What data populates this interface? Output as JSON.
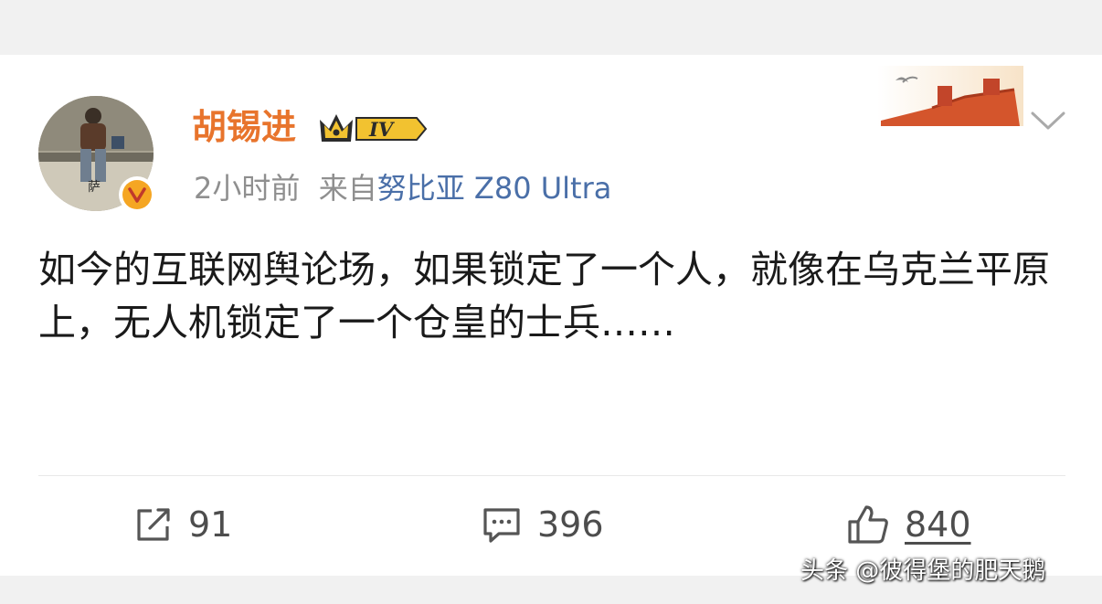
{
  "post": {
    "author": {
      "name": "胡锡进",
      "vip_level": "IV",
      "verified_icon": "verified-v-icon",
      "avatar_caption": "萨"
    },
    "time": "2小时前",
    "source_prefix": "来自",
    "device": "努比亚 Z80 Ultra",
    "content": "如今的互联网舆论场，如果锁定了一个人，就像在乌克兰平原上，无人机锁定了一个仓皇的士兵……"
  },
  "actions": {
    "repost_count": "91",
    "comment_count": "396",
    "like_count": "840"
  },
  "watermark": "头条 @彼得堡的肥天鹅",
  "colors": {
    "username": "#e8742c",
    "device": "#4a6fa8",
    "meta": "#8f8f8f",
    "text": "#1a1a1a",
    "actions": "#4d4d4d"
  },
  "icons": [
    "crown-icon",
    "great-wall-banner-icon",
    "chevron-down-icon",
    "repost-icon",
    "comment-icon",
    "thumb-up-icon"
  ]
}
